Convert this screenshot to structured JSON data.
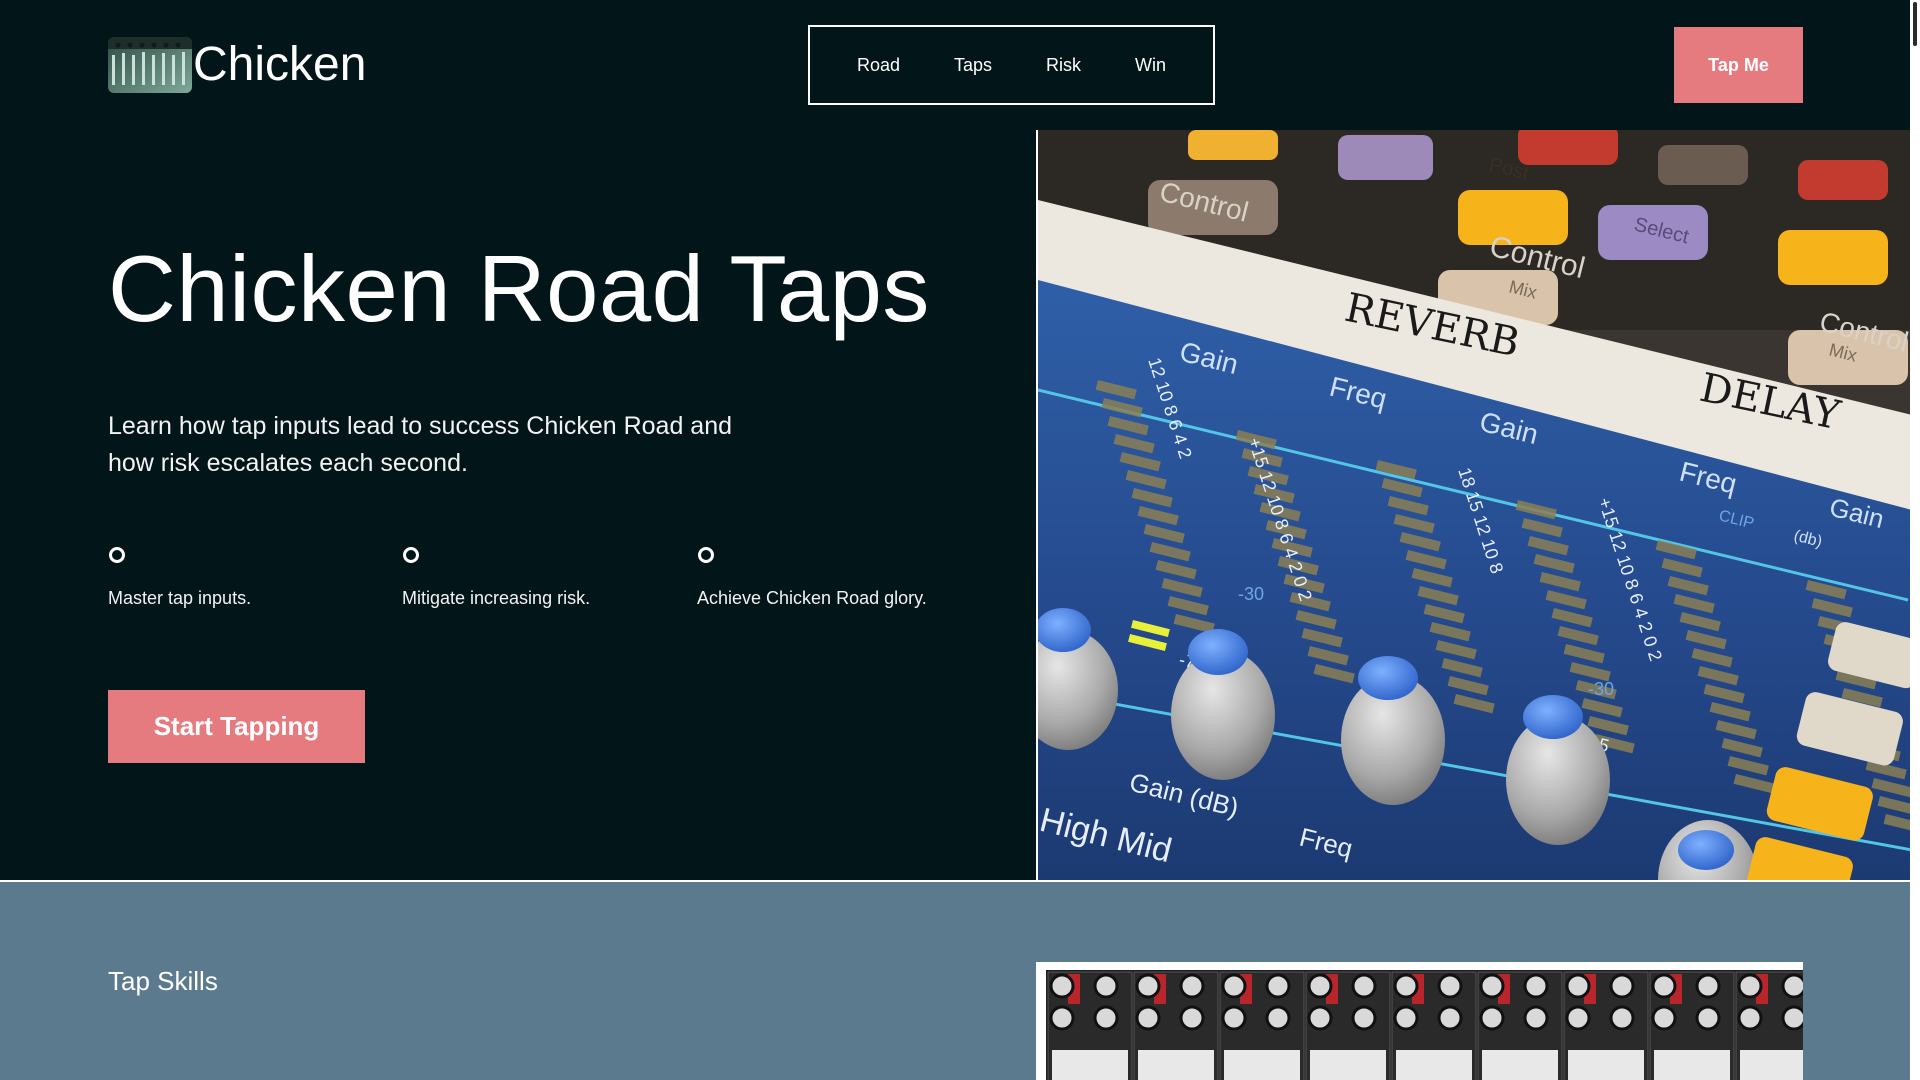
{
  "header": {
    "logo_text": "Chicken",
    "nav": [
      "Road",
      "Taps",
      "Risk",
      "Win"
    ],
    "cta_label": "Tap Me"
  },
  "hero": {
    "title": "Chicken Road Taps",
    "description": "Learn how tap inputs lead to success Chicken Road and how risk escalates each second.",
    "features": [
      "Master tap inputs.",
      "Mitigate increasing risk.",
      "Achieve Chicken Road glory."
    ],
    "cta_label": "Start Tapping"
  },
  "mixer_image": {
    "labels": {
      "reverb": "REVERB",
      "delay": "DELAY",
      "control": "Control",
      "mix": "Mix",
      "gain": "Gain",
      "freq": "Freq",
      "high_mid": "High Mid",
      "gain_db": "Gain (dB)",
      "post": "Post",
      "select": "Select",
      "clip": "CLIP",
      "db": "(db)"
    },
    "meter_scale": [
      "+15",
      "12",
      "10",
      "8",
      "6",
      "4",
      "2",
      "0",
      "2",
      "4",
      "6",
      "8",
      "10",
      "12",
      "-15"
    ]
  },
  "section2": {
    "title": "Tap Skills"
  },
  "colors": {
    "background": "#02161a",
    "accent": "#e57a7f",
    "section2": "#5c7a8e",
    "text": "#ffffff"
  },
  "icons": {
    "feature_icon": "ring-icon"
  }
}
